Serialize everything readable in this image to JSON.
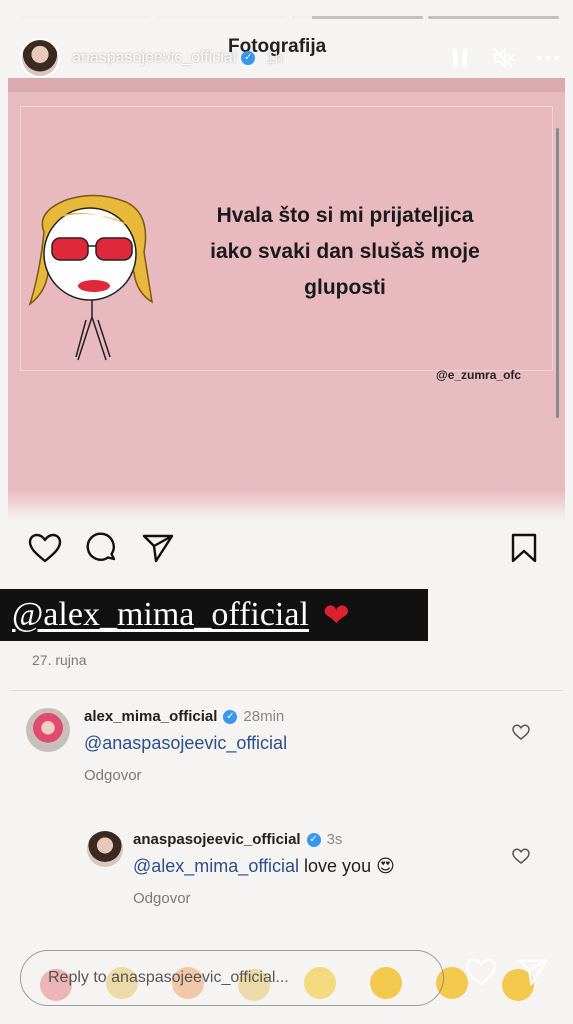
{
  "story": {
    "progress": [
      1,
      1,
      0.15,
      0
    ],
    "username": "anaspasojeevic_official",
    "verified_mark": "✓",
    "time": "1h",
    "title": "Fotografija"
  },
  "header_icons": [
    "pause-icon",
    "mute-icon",
    "more-icon"
  ],
  "post": {
    "meme_lines": [
      "Hvala što si mi prijateljica",
      "iako svaki dan slušaš moje",
      "gluposti"
    ],
    "credit": "@e_zumra_ofc",
    "mention": "@alex_mima_official",
    "mention_emoji": "❤",
    "date": "27. rujna"
  },
  "comments": [
    {
      "user": "alex_mima_official",
      "verified_mark": "✓",
      "time": "28min",
      "mention": "@anaspasojeevic_official",
      "text": "",
      "reply": "Odgovor"
    },
    {
      "user": "anaspasojeevic_official",
      "verified_mark": "✓",
      "time": "3s",
      "mention": "@alex_mima_official",
      "text": "love you",
      "emoji": "😍",
      "reply": "Odgovor"
    }
  ],
  "reply_bar": {
    "placeholder": "Reply to anaspasojeevic_official..."
  },
  "colors": {
    "photo_bg": "#e7bcc0",
    "mention_bg": "#111111",
    "heart": "#e0202f",
    "link": "#2b4f8a",
    "verified": "#3897f0"
  }
}
